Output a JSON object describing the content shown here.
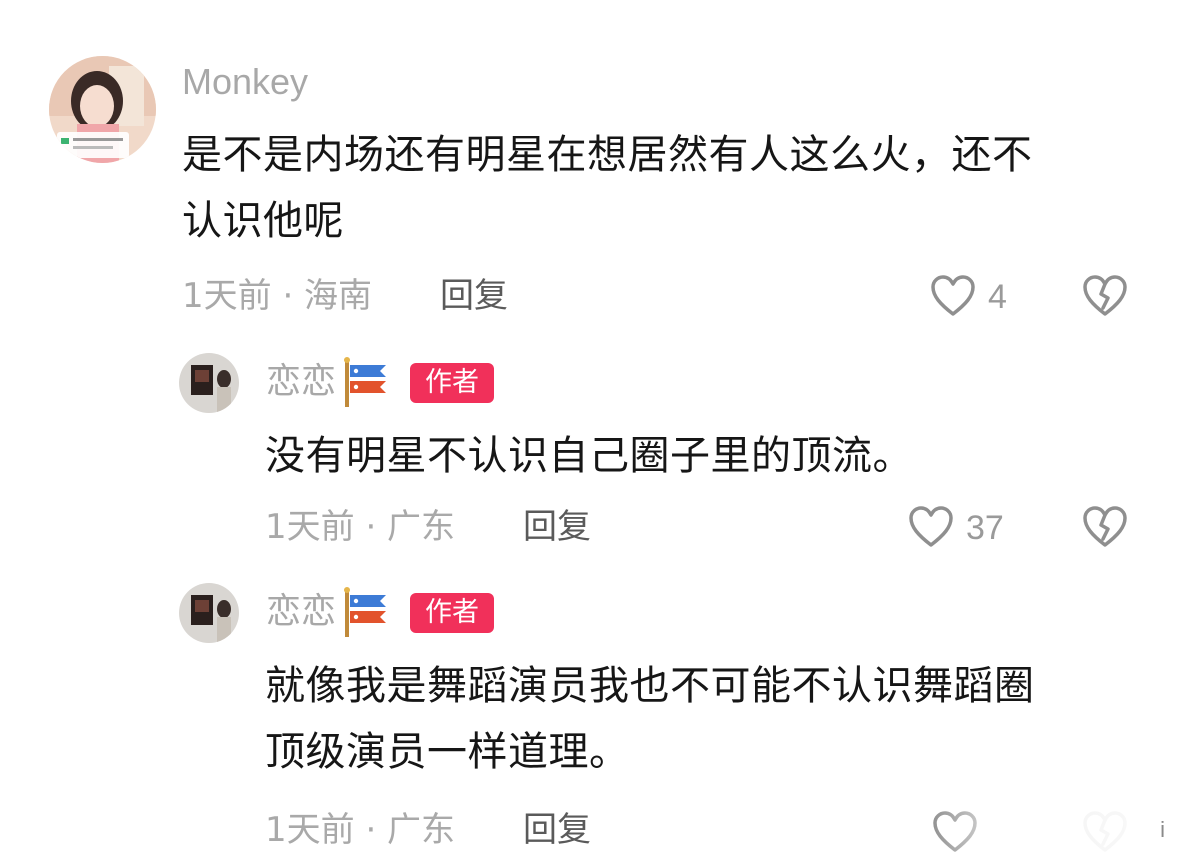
{
  "comments": [
    {
      "username": "Monkey",
      "text": "是不是内场还有明星在想居然有人这么火，还不\n认识他呢",
      "meta": "1天前 · 海南",
      "reply_label": "回复",
      "likes": "4"
    },
    {
      "username": "恋恋",
      "author_badge": "作者",
      "text": "没有明星不认识自己圈子里的顶流。",
      "meta": "1天前 · 广东",
      "reply_label": "回复",
      "likes": "37"
    },
    {
      "username": "恋恋",
      "author_badge": "作者",
      "text": "就像我是舞蹈演员我也不可能不认识舞蹈圈\n顶级演员一样道理。",
      "meta": "1天前 · 广东",
      "reply_label": "回复",
      "likes": ""
    }
  ],
  "watermark": "i",
  "icons": {
    "like": "heart-outline-icon",
    "dislike": "broken-heart-icon",
    "username_badge": "koinobori-flag-icon"
  },
  "colors": {
    "author_badge": "#f1305a",
    "text": "#161616",
    "muted": "#a9a9a9",
    "reply": "#5a5a5a"
  }
}
